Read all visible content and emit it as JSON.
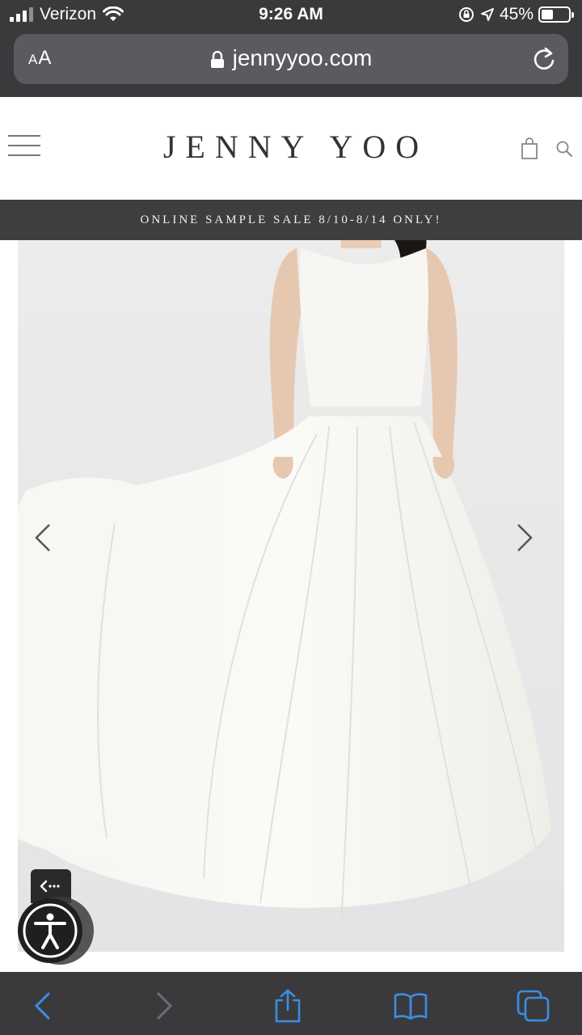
{
  "status_bar": {
    "carrier": "Verizon",
    "time": "9:26 AM",
    "battery_percent": "45%",
    "battery_level": 0.45
  },
  "address_bar": {
    "reader_label_small": "A",
    "reader_label_large": "A",
    "url": "jennyyoo.com"
  },
  "site": {
    "brand": "JENNY YOO",
    "promo_banner": "ONLINE SAMPLE SALE 8/10-8/14 ONLY!"
  },
  "colors": {
    "chrome_bg": "#3a3a3c",
    "url_field_bg": "#5b5b5f",
    "toolbar_accent": "#3a8ee6",
    "toolbar_disabled": "#6d6d72",
    "promo_bg": "#3e3e3e"
  },
  "icons": {
    "menu": "hamburger-icon",
    "cart": "shopping-bag-icon",
    "search": "search-icon",
    "prev": "chevron-left-icon",
    "next": "chevron-right-icon",
    "accessibility": "accessibility-person-icon",
    "back": "back-arrow-icon",
    "forward": "forward-arrow-icon",
    "share": "share-icon",
    "bookmarks": "book-icon",
    "tabs": "tabs-icon"
  }
}
